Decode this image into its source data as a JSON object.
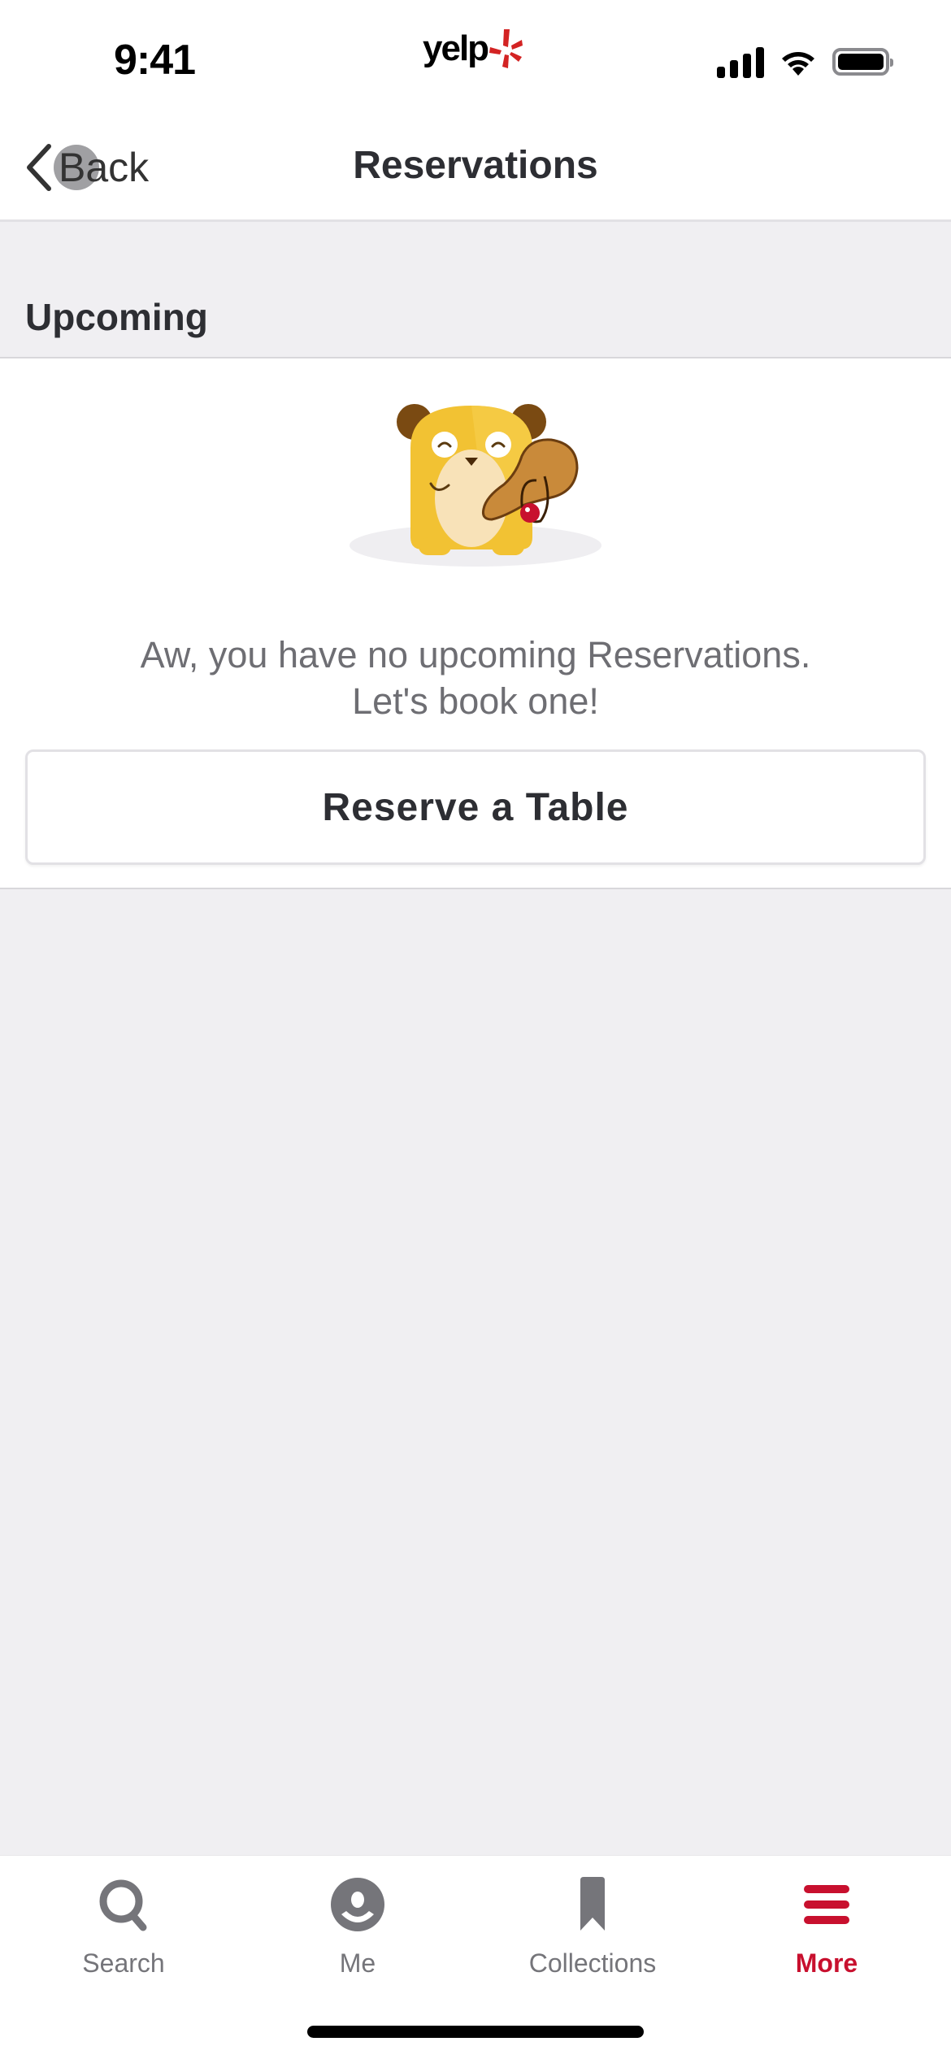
{
  "status_bar": {
    "time": "9:41",
    "logo_text": "yelp",
    "icons": [
      "cellular-signal-icon",
      "wifi-icon",
      "battery-icon"
    ]
  },
  "nav": {
    "back_label": "Back",
    "title": "Reservations"
  },
  "section": {
    "title": "Upcoming"
  },
  "empty_state": {
    "illustration": "hamster-with-paddle-ball",
    "message_line1": "Aw, you have no upcoming Reservations.",
    "message_line2": "Let's book one!",
    "button_label": "Reserve a Table"
  },
  "tab_bar": {
    "tabs": [
      {
        "label": "Search",
        "icon": "search-icon",
        "active": false
      },
      {
        "label": "Me",
        "icon": "profile-icon",
        "active": false
      },
      {
        "label": "Collections",
        "icon": "bookmark-icon",
        "active": false
      },
      {
        "label": "More",
        "icon": "menu-icon",
        "active": true
      }
    ]
  },
  "colors": {
    "brand_red": "#c8102e",
    "background_gray": "#f0eff2",
    "text_primary": "#2d2e33",
    "text_secondary": "#6e6e73",
    "tab_inactive": "#75757a"
  }
}
